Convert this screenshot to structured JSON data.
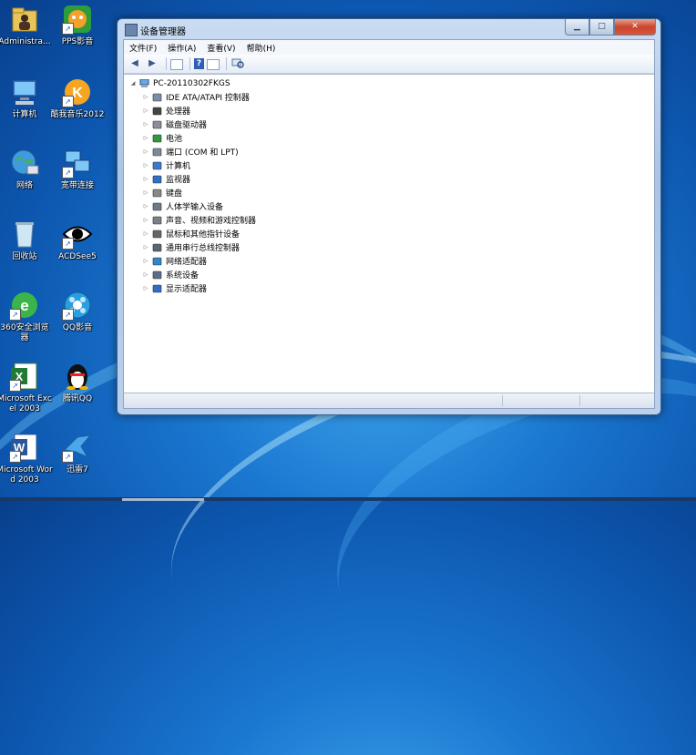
{
  "desktop": {
    "icons": [
      {
        "label": "Administra...",
        "icon": "user-folder-icon"
      },
      {
        "label": "PPS影音",
        "icon": "pps-player-icon"
      },
      {
        "label": "计算机",
        "icon": "computer-icon"
      },
      {
        "label": "酷我音乐2012",
        "icon": "kuwo-music-icon"
      },
      {
        "label": "网络",
        "icon": "network-icon"
      },
      {
        "label": "宽带连接",
        "icon": "broadband-connection-icon"
      },
      {
        "label": "回收站",
        "icon": "recycle-bin-icon"
      },
      {
        "label": "ACDSee5",
        "icon": "acdsee-eye-icon"
      },
      {
        "label": "360安全浏览器",
        "icon": "360-browser-icon"
      },
      {
        "label": "QQ影音",
        "icon": "qq-player-icon"
      },
      {
        "label": "Microsoft Excel 2003",
        "icon": "excel-icon"
      },
      {
        "label": "腾讯QQ",
        "icon": "qq-penguin-icon"
      },
      {
        "label": "Microsoft Word 2003",
        "icon": "word-icon"
      },
      {
        "label": "迅雷7",
        "icon": "xunlei-bird-icon"
      }
    ]
  },
  "window": {
    "title": "设备管理器",
    "controls": {
      "minimize": "▁",
      "maximize": "□",
      "close": "✕"
    },
    "menu": [
      "文件(F)",
      "操作(A)",
      "查看(V)",
      "帮助(H)"
    ],
    "toolbar": {
      "back": "◀",
      "forward": "▶",
      "help": "?"
    },
    "tree": {
      "root": "PC-20110302FKGS",
      "nodes": [
        {
          "label": "IDE ATA/ATAPI 控制器",
          "icon": "ide-controller-icon"
        },
        {
          "label": "处理器",
          "icon": "processor-icon"
        },
        {
          "label": "磁盘驱动器",
          "icon": "disk-drive-icon"
        },
        {
          "label": "电池",
          "icon": "battery-icon"
        },
        {
          "label": "端口 (COM 和 LPT)",
          "icon": "port-icon"
        },
        {
          "label": "计算机",
          "icon": "computer-icon"
        },
        {
          "label": "监视器",
          "icon": "monitor-icon"
        },
        {
          "label": "键盘",
          "icon": "keyboard-icon"
        },
        {
          "label": "人体学输入设备",
          "icon": "hid-icon"
        },
        {
          "label": "声音、视频和游戏控制器",
          "icon": "sound-icon"
        },
        {
          "label": "鼠标和其他指针设备",
          "icon": "mouse-icon"
        },
        {
          "label": "通用串行总线控制器",
          "icon": "usb-icon"
        },
        {
          "label": "网络适配器",
          "icon": "network-adapter-icon"
        },
        {
          "label": "系统设备",
          "icon": "system-device-icon"
        },
        {
          "label": "显示适配器",
          "icon": "display-adapter-icon"
        }
      ]
    }
  }
}
